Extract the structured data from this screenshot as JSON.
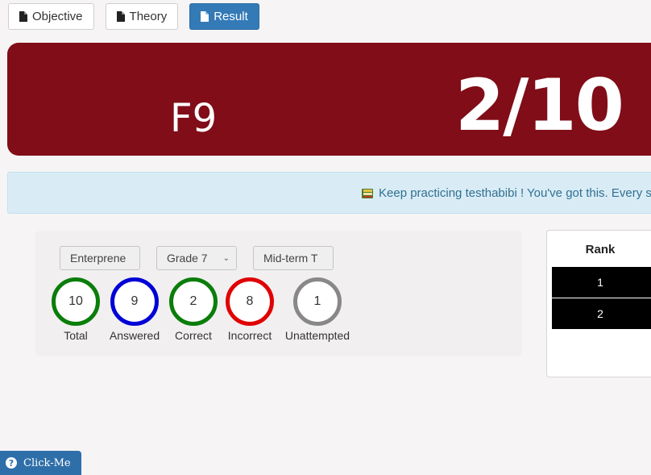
{
  "tabs": [
    {
      "label": "Objective",
      "icon": "file-icon",
      "active": false
    },
    {
      "label": "Theory",
      "icon": "file-icon",
      "active": false
    },
    {
      "label": "Result",
      "icon": "file-icon",
      "active": true
    }
  ],
  "banner": {
    "grade": "F9",
    "score": "2/10",
    "color": "#800d17"
  },
  "alert": {
    "message": "Keep practicing testhabibi ! You've got this. Every st",
    "icon": "book-icon"
  },
  "filters": {
    "subject": "Enterprene",
    "grade": "Grade 7",
    "term": "Mid-term T"
  },
  "stats": [
    {
      "value": "10",
      "label": "Total",
      "color": "#0a7d0a"
    },
    {
      "value": "9",
      "label": "Answered",
      "color": "#0000d6"
    },
    {
      "value": "2",
      "label": "Correct",
      "color": "#0a7d0a"
    },
    {
      "value": "8",
      "label": "Incorrect",
      "color": "#e00000"
    },
    {
      "value": "1",
      "label": "Unattempted",
      "color": "#888888"
    }
  ],
  "rank": {
    "header": "Rank",
    "rows": [
      "1",
      "2"
    ]
  },
  "help": {
    "label": "Click-Me",
    "icon": "question-icon"
  }
}
